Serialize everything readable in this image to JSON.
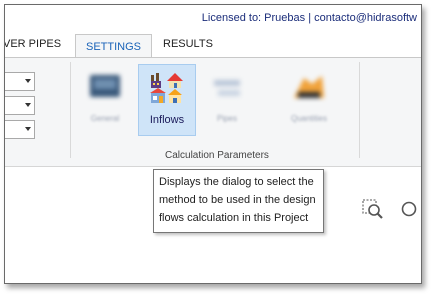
{
  "license": {
    "text": "Licensed to: Pruebas | contacto@hidrasoftw"
  },
  "tabs": [
    {
      "label": "VER PIPES"
    },
    {
      "label": "SETTINGS"
    },
    {
      "label": "RESULTS"
    }
  ],
  "ribbon": {
    "buttons": [
      {
        "label": "General"
      },
      {
        "label": "Inflows"
      },
      {
        "label": "Pipes"
      },
      {
        "label": "Quantities"
      }
    ],
    "group_label": "Calculation Parameters"
  },
  "tooltip": {
    "text": "Displays the dialog to select the method to be used in the design flows calculation in this Project"
  },
  "colors": {
    "accent": "#1a63b8",
    "selected_bg": "#cfe4f8",
    "ribbon_bg": "#f5f6f7"
  },
  "icons": [
    "chevron-down-icon",
    "houses-icon",
    "zoom-icon"
  ]
}
